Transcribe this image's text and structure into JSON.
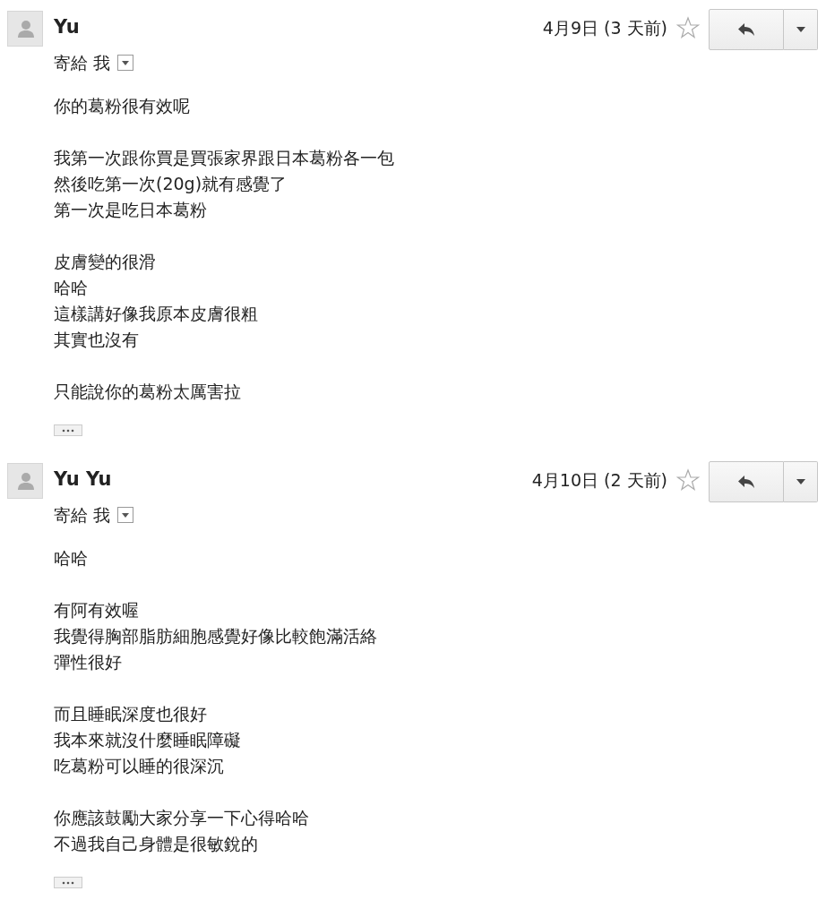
{
  "messages": [
    {
      "sender": "Yu",
      "date": "4月9日 (3 天前)",
      "starred": false,
      "recipient": "寄給 我",
      "paragraphs": [
        [
          "你的葛粉很有效呢"
        ],
        [
          "我第一次跟你買是買張家界跟日本葛粉各一包",
          "然後吃第一次(20g)就有感覺了",
          "第一次是吃日本葛粉"
        ],
        [
          "皮膚變的很滑",
          "哈哈",
          "這樣講好像我原本皮膚很粗",
          "其實也沒有"
        ],
        [
          "只能說你的葛粉太厲害拉"
        ]
      ]
    },
    {
      "sender": "Yu Yu",
      "date": "4月10日 (2 天前)",
      "starred": false,
      "recipient": "寄給 我",
      "paragraphs": [
        [
          "哈哈"
        ],
        [
          "有阿有效喔",
          "我覺得胸部脂肪細胞感覺好像比較飽滿活絡",
          "彈性很好"
        ],
        [
          "而且睡眠深度也很好",
          "我本來就沒什麼睡眠障礙",
          "吃葛粉可以睡的很深沉"
        ],
        [
          "你應該鼓勵大家分享一下心得哈哈",
          "不過我自己身體是很敏銳的"
        ]
      ]
    }
  ]
}
